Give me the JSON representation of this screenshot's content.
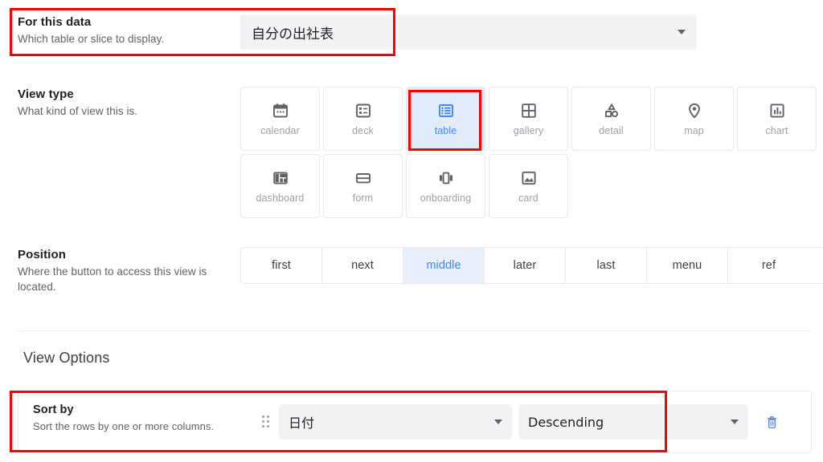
{
  "sections": {
    "for_this_data": {
      "title": "For this data",
      "subtitle": "Which table or slice to display.",
      "selected_value": "自分の出社表",
      "caret_icon": "chevron-down-icon"
    },
    "view_type": {
      "title": "View type",
      "subtitle": "What kind of view this is.",
      "selected": "table",
      "tiles_row1": [
        {
          "label": "calendar",
          "icon": "calendar-icon",
          "selected": false
        },
        {
          "label": "deck",
          "icon": "deck-icon",
          "selected": false
        },
        {
          "label": "table",
          "icon": "table-icon",
          "selected": true
        },
        {
          "label": "gallery",
          "icon": "gallery-icon",
          "selected": false
        },
        {
          "label": "detail",
          "icon": "detail-icon",
          "selected": false
        },
        {
          "label": "map",
          "icon": "map-pin-icon",
          "selected": false
        },
        {
          "label": "chart",
          "icon": "chart-icon",
          "selected": false
        }
      ],
      "tiles_row2": [
        {
          "label": "dashboard",
          "icon": "dashboard-icon",
          "selected": false
        },
        {
          "label": "form",
          "icon": "form-icon",
          "selected": false
        },
        {
          "label": "onboarding",
          "icon": "onboarding-icon",
          "selected": false
        },
        {
          "label": "card",
          "icon": "card-icon",
          "selected": false
        }
      ]
    },
    "position": {
      "title": "Position",
      "subtitle": "Where the button to access this view is located.",
      "selected": "middle",
      "options": [
        {
          "label": "first",
          "selected": false
        },
        {
          "label": "next",
          "selected": false
        },
        {
          "label": "middle",
          "selected": true
        },
        {
          "label": "later",
          "selected": false
        },
        {
          "label": "last",
          "selected": false
        },
        {
          "label": "menu",
          "selected": false
        },
        {
          "label": "ref",
          "selected": false
        }
      ]
    },
    "view_options": {
      "heading": "View Options",
      "sort_by": {
        "title": "Sort by",
        "subtitle": "Sort the rows by one or more columns.",
        "drag_handle_icon": "drag-handle-icon",
        "column_value": "日付",
        "direction_value": "Descending",
        "delete_icon": "trash-icon"
      }
    }
  },
  "colors": {
    "accent_blue": "#4285f4",
    "selected_tile_bg": "#e2ecfd",
    "selected_segment_bg": "#e8f0fe",
    "field_bg": "#f1f3f4",
    "border": "#e8eaed",
    "text_primary": "#202124",
    "text_secondary": "#5f6368",
    "text_muted": "#9aa0a6",
    "annotation_red": "#ff0000"
  }
}
